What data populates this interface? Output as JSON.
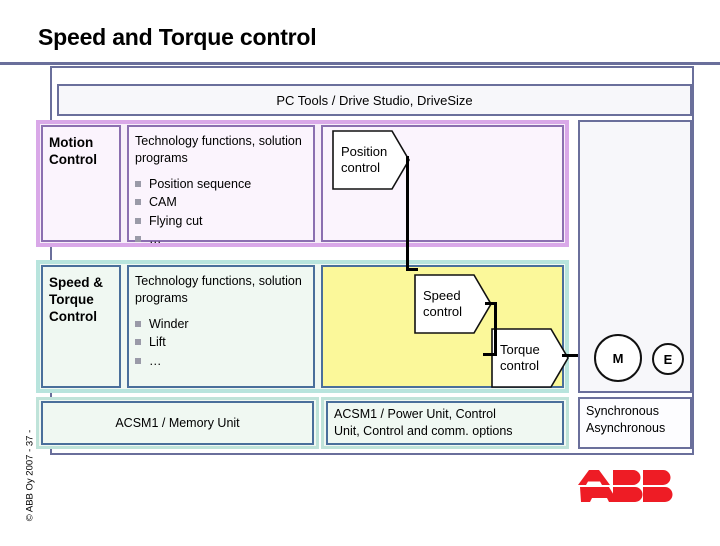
{
  "slide": {
    "title": "Speed and Torque control",
    "copyright": "© ABB Oy 2007 - 37 -",
    "logo_alt": "ABB",
    "logo_color": "#ee1c25"
  },
  "pc_tools": {
    "label": "PC Tools / Drive Studio, DriveSize"
  },
  "colors": {
    "frame_border": "#6a6f9b",
    "motion_group_border": "#d9a8e8",
    "motion_box_border": "#8b6fb0",
    "motion_box_fill": "#fbf4fd",
    "st_group_border": "#b8e4dd",
    "st_box_border": "#4a6f9b",
    "st_box_fill": "#f0f8f2",
    "yellow_fill": "#fbf89a",
    "bullet": "#9a9aa8"
  },
  "rows": {
    "motion": {
      "label": "Motion\nControl",
      "label_line1": "Motion",
      "label_line2": "Control",
      "tech_heading": "Technology functions, solution programs",
      "bullets": [
        "Position sequence",
        "CAM",
        "Flying cut",
        "…"
      ],
      "control_block": {
        "line1": "Position",
        "line2": "control"
      }
    },
    "speed_torque": {
      "label_line1": "Speed &",
      "label_line2": "Torque",
      "label_line3": "Control",
      "tech_heading": "Technology functions, solution programs",
      "bullets": [
        "Winder",
        "Lift",
        "…"
      ],
      "control_blocks": [
        {
          "line1": "Speed",
          "line2": "control"
        },
        {
          "line1": "Torque",
          "line2": "control"
        }
      ]
    },
    "hardware": {
      "left": "ACSM1 / Memory Unit",
      "right_line1": "ACSM1 / Power Unit, Control",
      "right_line2": "Unit, Control and comm. options"
    }
  },
  "motor": {
    "machine_label": "M",
    "encoder_label": "E",
    "type_line1": "Synchronous",
    "type_line2": "Asynchronous"
  }
}
